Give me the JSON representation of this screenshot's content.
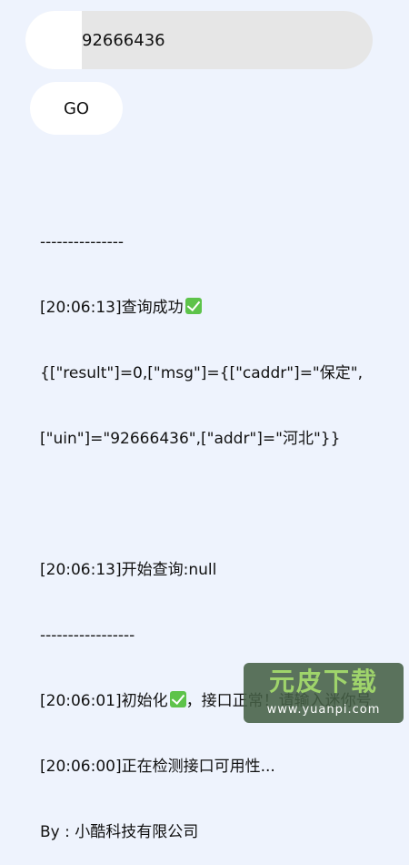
{
  "search": {
    "value": "92666436",
    "placeholder": ""
  },
  "go_button": {
    "label": "GO"
  },
  "log": {
    "lines": [
      "---------------",
      "[20:06:13]查询成功",
      "{[\"result\"]=0,[\"msg\"]={[\"caddr\"]=\"保定\",",
      "[\"uin\"]=\"92666436\",[\"addr\"]=\"河北\"}}",
      "",
      "[20:06:13]开始查询:null",
      "-----------------",
      "[20:06:01]初始化",
      "，接口正常！请输入迷你号",
      "[20:06:00]正在检测接口可用性...",
      "By : 小酷科技有限公司"
    ]
  },
  "icons": {
    "success": "check-mark-icon"
  },
  "colors": {
    "background": "#eef3fd",
    "check": "#5dc34a",
    "watermark_text": "#9fd46b"
  },
  "watermark": {
    "title": "元皮下载",
    "url": "www.yuanpi.com"
  }
}
